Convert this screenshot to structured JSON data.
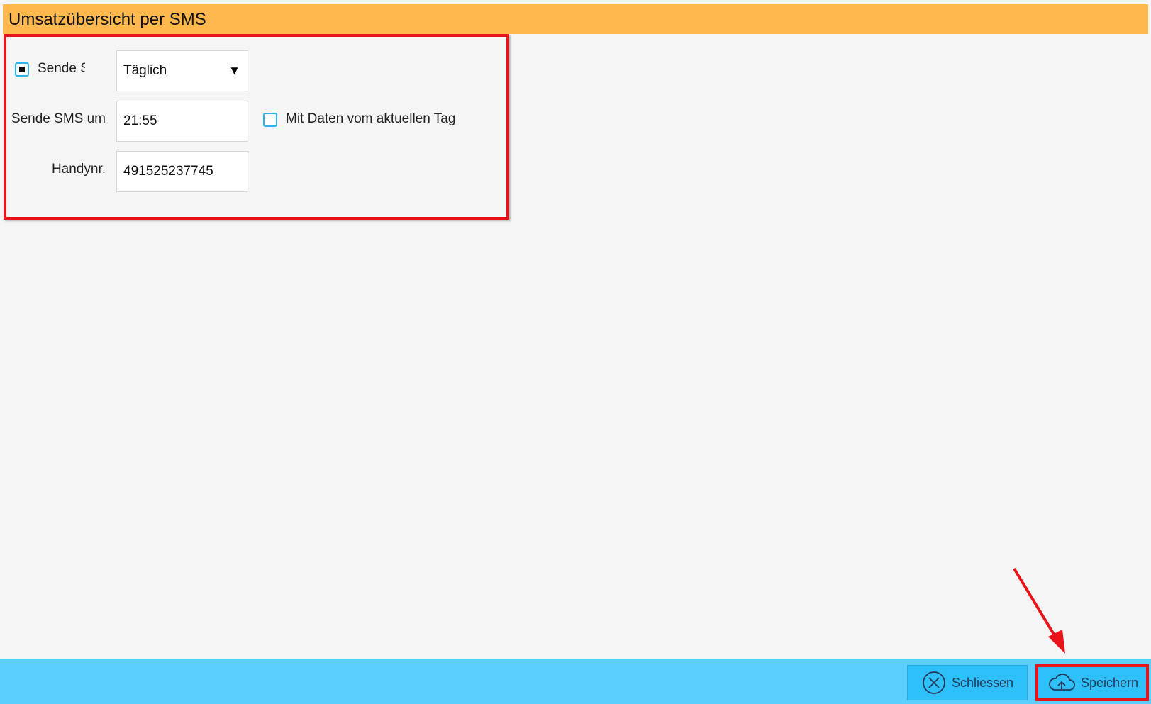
{
  "window": {
    "title": "Umsatzübersicht per SMS"
  },
  "form": {
    "send_checkbox": {
      "label": "Sende SMS",
      "checked": true
    },
    "frequency_select": {
      "value": "Täglich"
    },
    "send_time": {
      "label": "Sende SMS um",
      "value": "21:55"
    },
    "current_day_checkbox": {
      "label": "Mit Daten vom aktuellen Tag",
      "checked": false
    },
    "phone": {
      "label": "Handynr.",
      "value": "491525237745"
    }
  },
  "footer": {
    "close_label": "Schliessen",
    "save_label": "Speichern"
  },
  "colors": {
    "title_bar": "#ffb84e",
    "footer_bar": "#5bcffd",
    "button": "#2ec0f9",
    "highlight": "#e8141a",
    "checkbox_border": "#2bb4ef"
  },
  "icons": {
    "frequency_select": "caret-down-icon",
    "close_button": "close-circle-icon",
    "save_button": "cloud-upload-icon"
  }
}
